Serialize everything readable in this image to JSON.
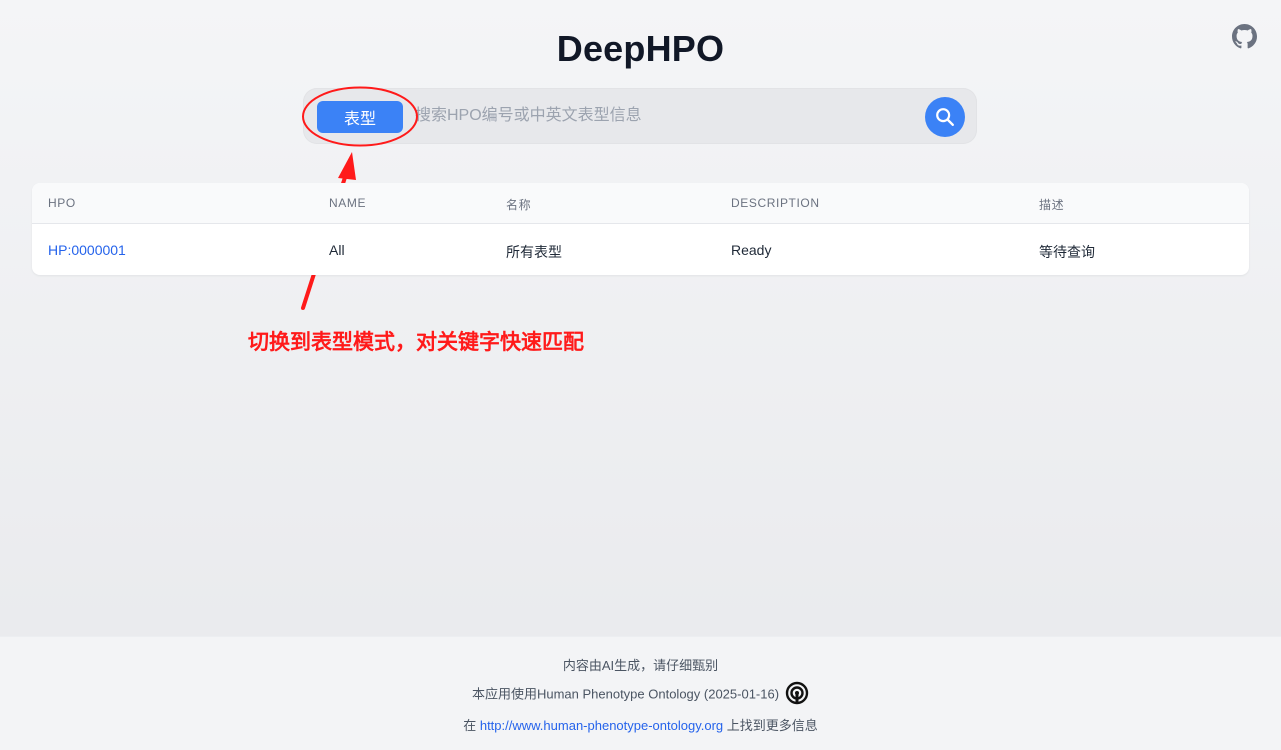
{
  "header": {
    "title": "DeepHPO",
    "github_icon": "github-icon"
  },
  "search": {
    "mode_label": "表型",
    "placeholder": "搜索HPO编号或中英文表型信息",
    "value": "",
    "search_icon": "search-icon"
  },
  "annotation": {
    "text": "切换到表型模式，对关键字快速匹配",
    "color": "#ff1a1a"
  },
  "table": {
    "columns": [
      "HPO",
      "NAME",
      "名称",
      "DESCRIPTION",
      "描述"
    ],
    "rows": [
      [
        "HP:0000001",
        "All",
        "所有表型",
        "Ready",
        "等待查询"
      ]
    ]
  },
  "footer": {
    "line1": "内容由AI生成，请仔细甄别",
    "line2": "本应用使用Human Phenotype Ontology (2025-01-16)",
    "line3_prefix": "在",
    "line3_link": "http://www.human-phenotype-ontology.org",
    "line3_suffix": "上找到更多信息"
  },
  "colors": {
    "accent": "#3b82f6",
    "link": "#2563eb"
  }
}
